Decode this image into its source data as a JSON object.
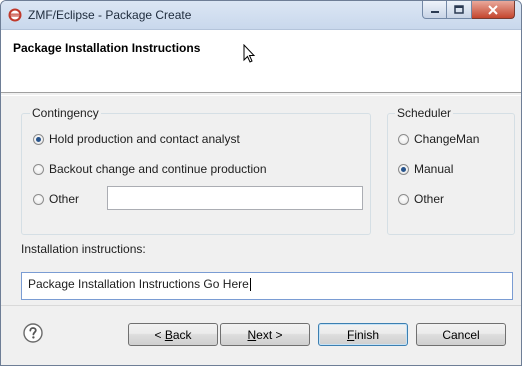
{
  "window": {
    "title": "ZMF/Eclipse - Package Create",
    "app_icon": "eclipse-icon",
    "controls": [
      "minimize-icon",
      "maximize-icon",
      "close-icon"
    ]
  },
  "header": {
    "title": "Package Installation Instructions"
  },
  "contingency": {
    "legend": "Contingency",
    "options": [
      {
        "label": "Hold production and contact analyst",
        "checked": true
      },
      {
        "label": "Backout change and continue production",
        "checked": false
      },
      {
        "label": "Other",
        "checked": false
      }
    ],
    "other_value": ""
  },
  "scheduler": {
    "legend": "Scheduler",
    "options": [
      {
        "label": "ChangeMan",
        "checked": false
      },
      {
        "label": "Manual",
        "checked": true
      },
      {
        "label": "Other",
        "checked": false
      }
    ]
  },
  "installation": {
    "label": "Installation instructions:",
    "value": "Package Installation Instructions Go Here"
  },
  "buttons": {
    "back": {
      "prefix": "< ",
      "mnemonic": "B",
      "rest": "ack"
    },
    "next": {
      "mnemonic": "N",
      "rest": "ext >"
    },
    "finish": {
      "mnemonic": "F",
      "rest": "inish"
    },
    "cancel": {
      "label": "Cancel"
    }
  },
  "icons": {
    "help": "help-icon"
  },
  "colors": {
    "accent": "#3c7fb1",
    "radio_dot": "#27548c",
    "close_button": "#c4452e"
  }
}
